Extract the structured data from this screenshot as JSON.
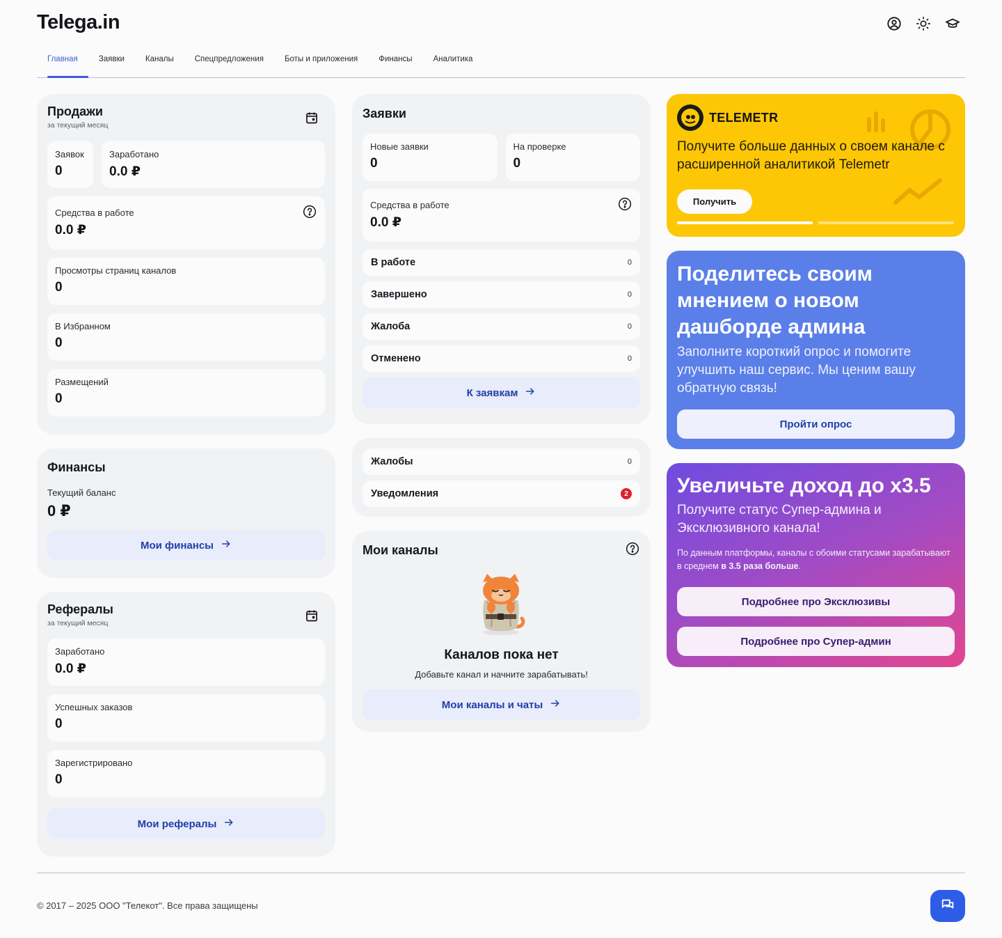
{
  "header": {
    "logo": "Telega.in",
    "icons": [
      "user-circle-icon",
      "sun-icon",
      "graduation-cap-icon"
    ]
  },
  "tabs": [
    {
      "label": "Главная",
      "active": true
    },
    {
      "label": "Заявки",
      "active": false
    },
    {
      "label": "Каналы",
      "active": false
    },
    {
      "label": "Спецпредложения",
      "active": false
    },
    {
      "label": "Боты и приложения",
      "active": false
    },
    {
      "label": "Финансы",
      "active": false
    },
    {
      "label": "Аналитика",
      "active": false
    }
  ],
  "sales": {
    "title": "Продажи",
    "subtitle": "за текущий месяц",
    "requests_label": "Заявок",
    "requests_value": "0",
    "earned_label": "Заработано",
    "earned_value": "0.0 ₽",
    "funds_label": "Средства в работе",
    "funds_value": "0.0 ₽",
    "views_label": "Просмотры страниц каналов",
    "views_value": "0",
    "favorites_label": "В Избранном",
    "favorites_value": "0",
    "placements_label": "Размещений",
    "placements_value": "0"
  },
  "finance": {
    "title": "Финансы",
    "balance_label": "Текущий баланс",
    "balance_value": "0 ₽",
    "button": "Мои финансы"
  },
  "referrals": {
    "title": "Рефералы",
    "subtitle": "за текущий месяц",
    "earned_label": "Заработано",
    "earned_value": "0.0 ₽",
    "orders_label": "Успешных заказов",
    "orders_value": "0",
    "registered_label": "Зарегистрировано",
    "registered_value": "0",
    "button": "Мои рефералы"
  },
  "requests": {
    "title": "Заявки",
    "new_label": "Новые заявки",
    "new_value": "0",
    "review_label": "На проверке",
    "review_value": "0",
    "funds_label": "Средства в работе",
    "funds_value": "0.0 ₽",
    "statuses": [
      {
        "label": "В работе",
        "count": "0"
      },
      {
        "label": "Завершено",
        "count": "0"
      },
      {
        "label": "Жалоба",
        "count": "0"
      },
      {
        "label": "Отменено",
        "count": "0"
      }
    ],
    "button": "К заявкам"
  },
  "notifications": {
    "complaints_label": "Жалобы",
    "complaints_count": "0",
    "notices_label": "Уведомления",
    "notices_count": "2"
  },
  "channels": {
    "title": "Мои каналы",
    "empty_title": "Каналов пока нет",
    "empty_text": "Добавьте канал и начните зарабатывать!",
    "button": "Мои каналы и чаты"
  },
  "promo_telemetr": {
    "brand": "TELEMETR",
    "text": "Получите больше данных о своем канале с расширенной аналитикой Telemetr",
    "button": "Получить",
    "bg": "#fec705"
  },
  "promo_survey": {
    "title": "Поделитесь своим мнением о новом дашборде админа",
    "text": "Заполните короткий опрос и помогите улучшить наш сервис. Мы ценим вашу обратную связь!",
    "button": "Пройти опрос",
    "bg": "#5b7fe8"
  },
  "promo_income": {
    "title": "Увеличьте доход до x3.5",
    "text": "Получите статус Супер-админа и Эксклюзивного канала!",
    "note_prefix": "По данным платформы, каналы с обоими статусами зарабатывают в среднем ",
    "note_bold": "в 3.5 раза больше",
    "note_suffix": ".",
    "button_exclusive": "Подробнее про Эксклюзивы",
    "button_superadmin": "Подробнее про Супер-админ"
  },
  "footer": {
    "copyright": "© 2017 – 2025 ООО \"Телекот\". Все права защищены"
  }
}
